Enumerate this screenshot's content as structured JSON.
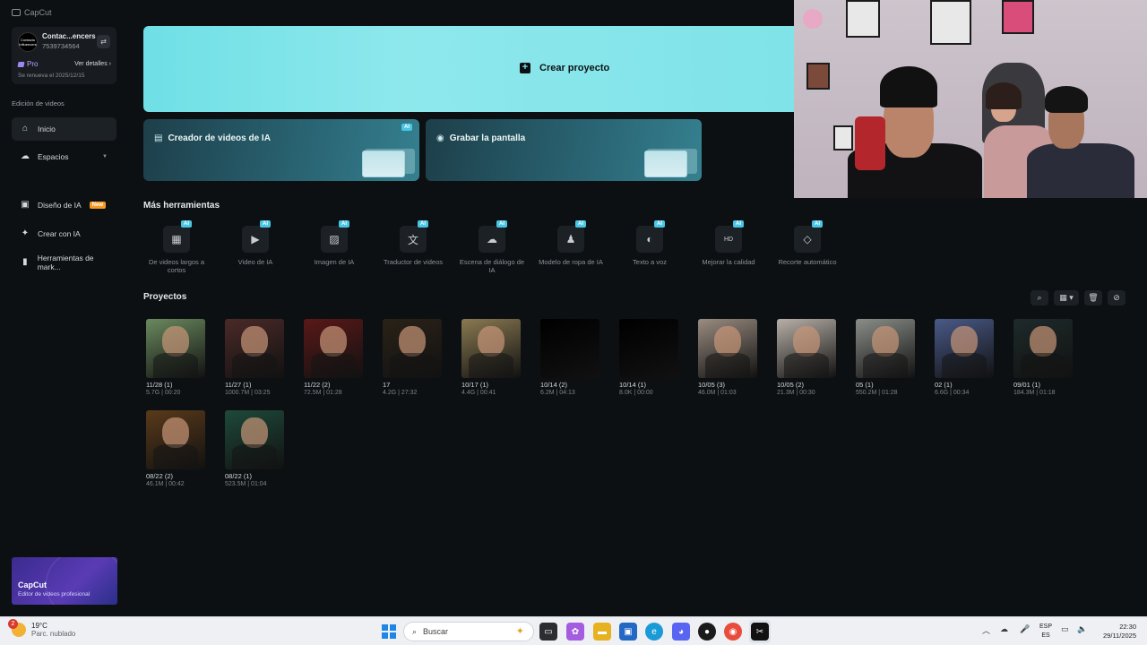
{
  "app": {
    "name": "CapCut"
  },
  "account": {
    "avatar_text": "Contacto Influencers",
    "name": "Contac...encers",
    "id": "7539734564",
    "plan": "Pro",
    "details_label": "Ver detalles",
    "renewal": "Se renueva el 2025/12/15"
  },
  "sidebar": {
    "section": "Edición de videos",
    "items": [
      {
        "label": "Inicio",
        "icon": "home-icon"
      },
      {
        "label": "Espacios",
        "icon": "cloud-icon"
      },
      {
        "label": "Diseño de IA",
        "icon": "design-icon",
        "badge": "New"
      },
      {
        "label": "Crear con IA",
        "icon": "sparkle-icon"
      },
      {
        "label": "Herramientas de mark...",
        "icon": "marketing-icon"
      }
    ],
    "promo": {
      "title": "CapCut",
      "subtitle": "Editor de videos profesional"
    }
  },
  "main": {
    "create_label": "Crear proyecto",
    "cards": [
      {
        "label": "Creador de videos de IA",
        "badge": "AI"
      },
      {
        "label": "Grabar la pantalla"
      }
    ],
    "tools_heading": "Más herramientas",
    "tools": [
      {
        "label": "De videos largos a cortos",
        "badge": "AI",
        "icon": "film-icon"
      },
      {
        "label": "Video de IA",
        "badge": "AI",
        "icon": "video-ai-icon"
      },
      {
        "label": "Imagen de IA",
        "badge": "AI",
        "icon": "image-ai-icon"
      },
      {
        "label": "Traductor de videos",
        "badge": "AI",
        "icon": "translate-icon"
      },
      {
        "label": "Escena de diálogo de IA",
        "badge": "AI",
        "icon": "dialog-icon"
      },
      {
        "label": "Modelo de ropa de IA",
        "badge": "AI",
        "icon": "clothing-icon"
      },
      {
        "label": "Texto a voz",
        "badge": "AI",
        "icon": "text-to-speech-icon"
      },
      {
        "label": "Mejorar la calidad",
        "badge": "AI",
        "icon": "hd-icon"
      },
      {
        "label": "Recorte automático",
        "badge": "AI",
        "icon": "eraser-icon"
      }
    ],
    "projects_heading": "Proyectos",
    "projects": [
      {
        "name": "11/28 (1)",
        "meta": "5.7G | 00:20",
        "thumb": "#6a8a5e"
      },
      {
        "name": "11/27 (1)",
        "meta": "1000.7M | 03:25",
        "thumb": "#4a2a28"
      },
      {
        "name": "11/22 (2)",
        "meta": "72.5M | 01:28",
        "thumb": "#5a1818"
      },
      {
        "name": "17",
        "meta": "4.2G | 27:32",
        "thumb": "#2a2218"
      },
      {
        "name": "10/17 (1)",
        "meta": "4.4G | 00:41",
        "thumb": "#8a7a52"
      },
      {
        "name": "10/14 (2)",
        "meta": "6.2M | 04:13",
        "thumb": "#000000"
      },
      {
        "name": "10/14 (1)",
        "meta": "8.0K | 00:00",
        "thumb": "#000000"
      },
      {
        "name": "10/05 (3)",
        "meta": "46.0M | 01:03",
        "thumb": "#9a8c80"
      },
      {
        "name": "10/05 (2)",
        "meta": "21.3M | 00:30",
        "thumb": "#b8b0a8"
      },
      {
        "name": "05 (1)",
        "meta": "550.2M | 01:28",
        "thumb": "#8a8e88"
      },
      {
        "name": "02 (1)",
        "meta": "6.6G | 00:34",
        "thumb": "#4a5a88"
      },
      {
        "name": "09/01 (1)",
        "meta": "184.3M | 01:18",
        "thumb": "#1e2a2a"
      },
      {
        "name": "08/22 (2)",
        "meta": "46.1M | 00:42",
        "thumb": "#5a3a1a"
      },
      {
        "name": "08/22 (1)",
        "meta": "523.5M | 01:04",
        "thumb": "#1e4a3a"
      }
    ]
  },
  "taskbar": {
    "weather_badge": "2",
    "temperature": "19°C",
    "condition": "Parc. nublado",
    "search_placeholder": "Buscar",
    "lang_top": "ESP",
    "lang_bottom": "ES",
    "time": "22:30",
    "date": "29/11/2025"
  }
}
